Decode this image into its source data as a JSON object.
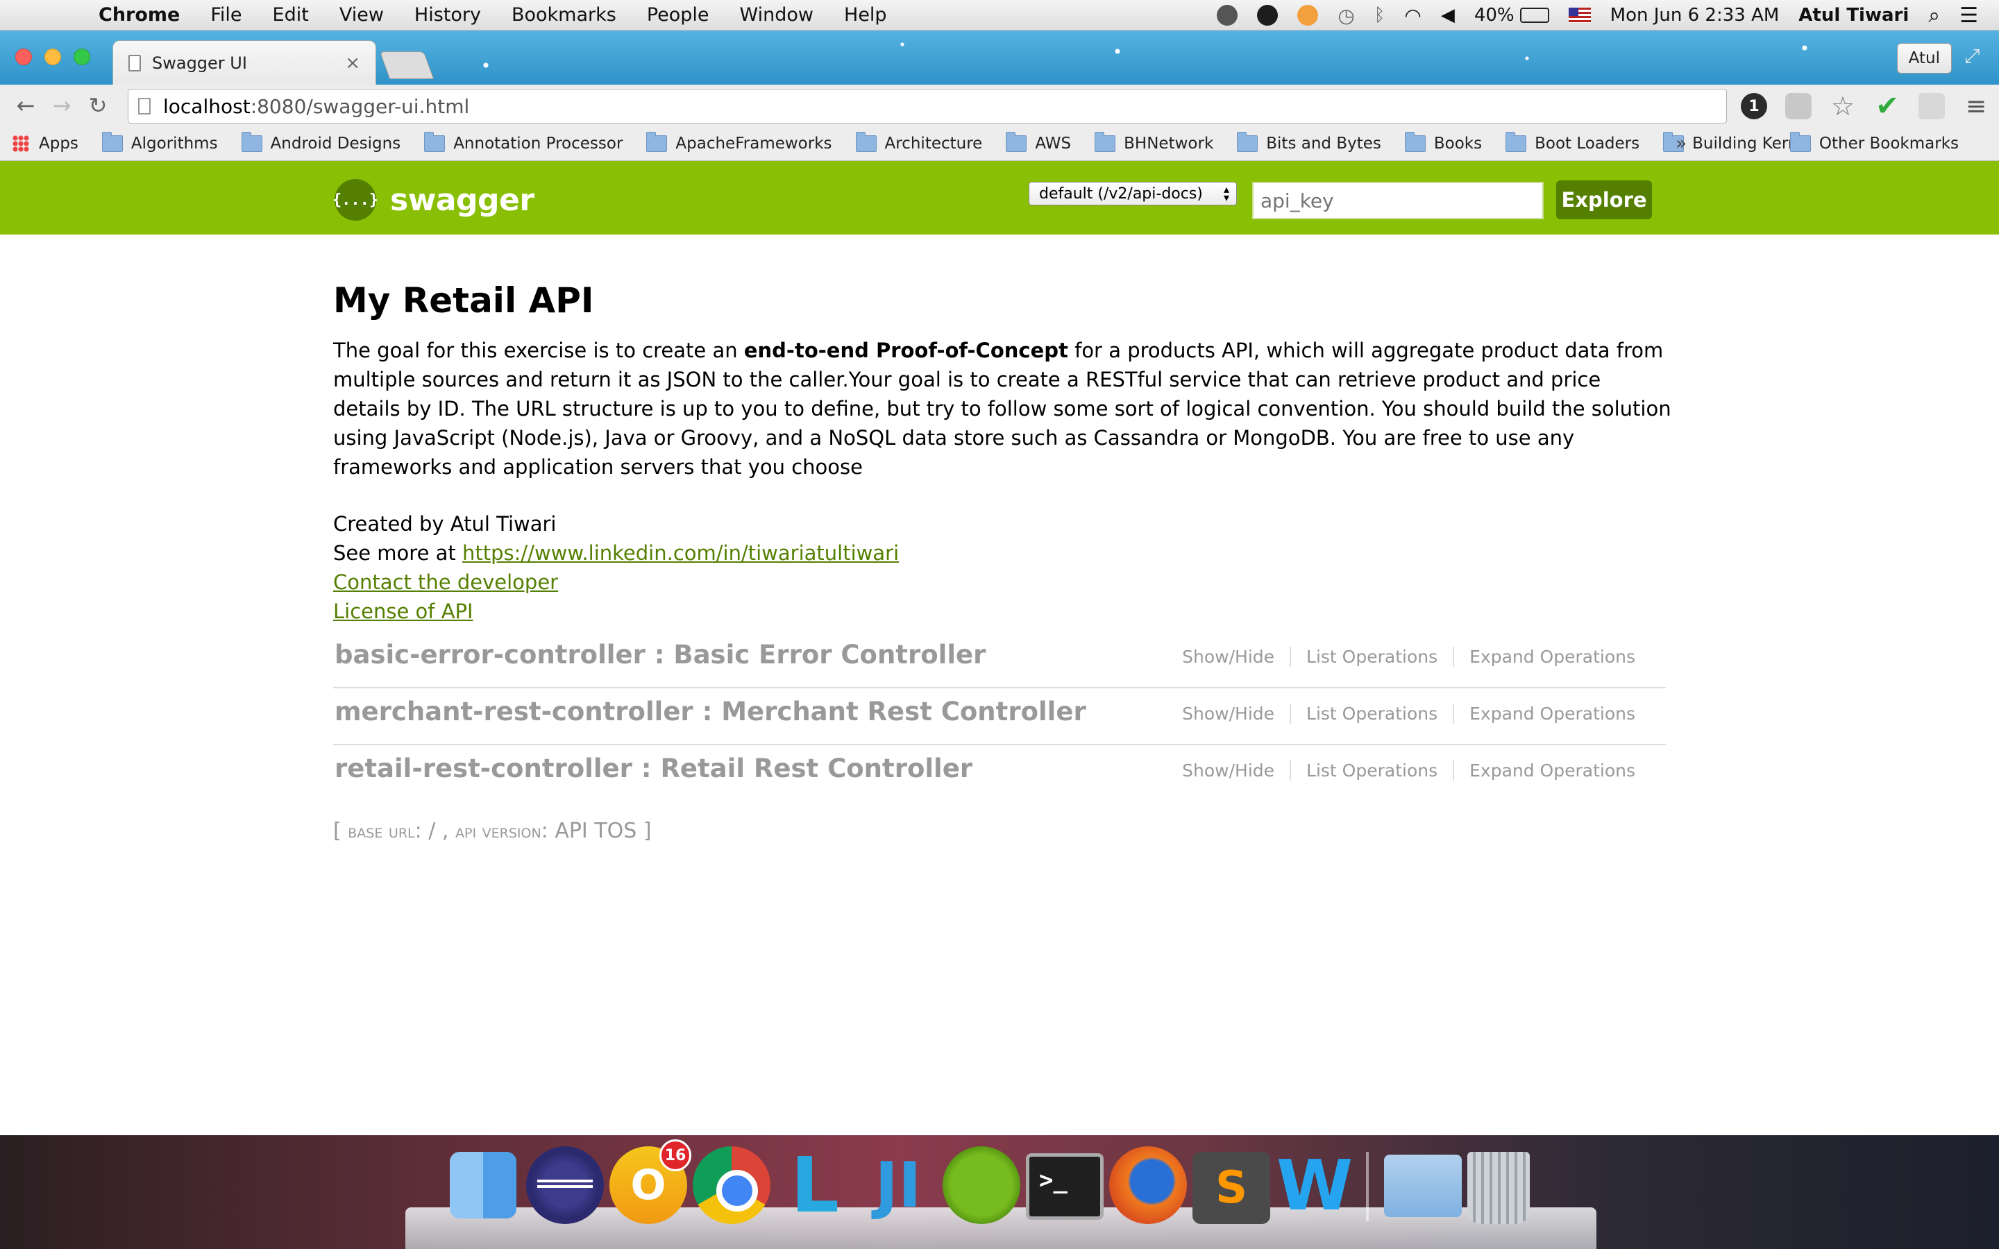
{
  "menubar": {
    "app": "Chrome",
    "items": [
      "File",
      "Edit",
      "View",
      "History",
      "Bookmarks",
      "People",
      "Window",
      "Help"
    ],
    "battery": "40%",
    "datetime": "Mon Jun 6  2:33 AM",
    "user": "Atul Tiwari"
  },
  "browser": {
    "tab_title": "Swagger UI",
    "profile": "Atul",
    "url_host": "localhost",
    "url_path": ":8080/swagger-ui.html",
    "onepassword_label": "1"
  },
  "bookmarks": {
    "apps": "Apps",
    "items": [
      "Algorithms",
      "Android Designs",
      "Annotation Processor",
      "ApacheFrameworks",
      "Architecture",
      "AWS",
      "BHNetwork",
      "Bits and Bytes",
      "Books",
      "Boot Loaders",
      "Building Kernel"
    ],
    "more": "»",
    "other": "Other Bookmarks"
  },
  "swagger": {
    "logo_icon": "{...}",
    "logo_text": "swagger",
    "api_select": "default (/v2/api-docs)",
    "api_key_placeholder": "api_key",
    "explore": "Explore"
  },
  "api": {
    "title": "My Retail API",
    "desc_pre": "The goal for this exercise is to create an ",
    "desc_bold": "end-to-end Proof-of-Concept",
    "desc_post": " for a products API, which will aggregate product data from multiple sources and return it as JSON to the caller.Your goal is to create a RESTful service that can retrieve product and price details by ID. The URL structure is up to you to define, but try to follow some sort of logical convention. You should build the solution using JavaScript (Node.js), Java or Groovy, and a NoSQL data store such as Cassandra or MongoDB. You are free to use any frameworks and application servers that you choose",
    "created_by": "Created by Atul Tiwari",
    "see_more_prefix": "See more at ",
    "linkedin": "https://www.linkedin.com/in/tiwariatultiwari",
    "contact": "Contact the developer",
    "license": "License of API"
  },
  "resources": [
    {
      "name": "basic-error-controller : Basic Error Controller",
      "show_hide": "Show/Hide",
      "list_ops": "List Operations",
      "expand_ops": "Expand Operations"
    },
    {
      "name": "merchant-rest-controller : Merchant Rest Controller",
      "show_hide": "Show/Hide",
      "list_ops": "List Operations",
      "expand_ops": "Expand Operations"
    },
    {
      "name": "retail-rest-controller : Retail Rest Controller",
      "show_hide": "Show/Hide",
      "list_ops": "List Operations",
      "expand_ops": "Expand Operations"
    }
  ],
  "footer": {
    "open": "[ ",
    "base_url_label": "base url",
    "base_url_value": ": / , ",
    "api_version_label": "api version",
    "api_version_value": ": API TOS ]"
  },
  "dock": {
    "outlook_badge": "16",
    "terminal_prompt": ">_",
    "sublime_glyph": "S",
    "word_glyph": "W",
    "lync_glyph": "L",
    "intellij_glyph": "JI",
    "outlook_glyph": "O"
  },
  "colors": {
    "swagger_green": "#89bf04",
    "swagger_dark_green": "#547f00",
    "link": "#547f00"
  }
}
